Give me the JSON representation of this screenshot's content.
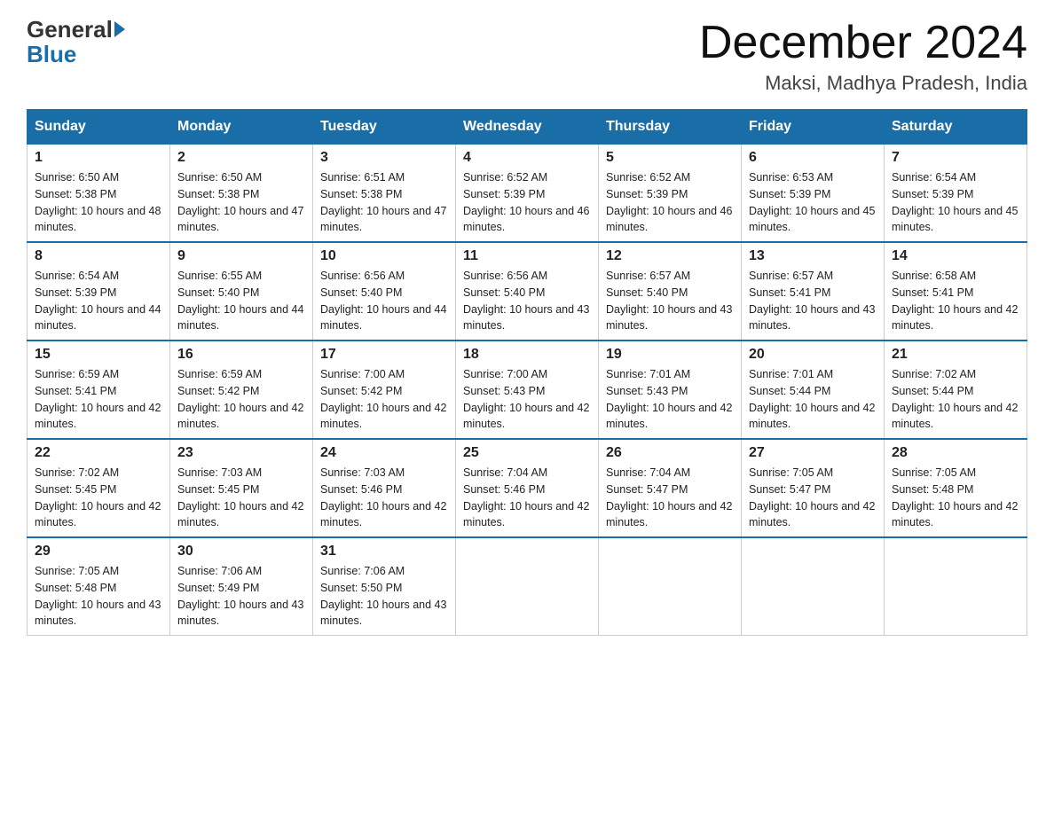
{
  "header": {
    "logo_general": "General",
    "logo_blue": "Blue",
    "title": "December 2024",
    "subtitle": "Maksi, Madhya Pradesh, India"
  },
  "days_of_week": [
    "Sunday",
    "Monday",
    "Tuesday",
    "Wednesday",
    "Thursday",
    "Friday",
    "Saturday"
  ],
  "weeks": [
    [
      {
        "day": "1",
        "sunrise": "6:50 AM",
        "sunset": "5:38 PM",
        "daylight": "10 hours and 48 minutes."
      },
      {
        "day": "2",
        "sunrise": "6:50 AM",
        "sunset": "5:38 PM",
        "daylight": "10 hours and 47 minutes."
      },
      {
        "day": "3",
        "sunrise": "6:51 AM",
        "sunset": "5:38 PM",
        "daylight": "10 hours and 47 minutes."
      },
      {
        "day": "4",
        "sunrise": "6:52 AM",
        "sunset": "5:39 PM",
        "daylight": "10 hours and 46 minutes."
      },
      {
        "day": "5",
        "sunrise": "6:52 AM",
        "sunset": "5:39 PM",
        "daylight": "10 hours and 46 minutes."
      },
      {
        "day": "6",
        "sunrise": "6:53 AM",
        "sunset": "5:39 PM",
        "daylight": "10 hours and 45 minutes."
      },
      {
        "day": "7",
        "sunrise": "6:54 AM",
        "sunset": "5:39 PM",
        "daylight": "10 hours and 45 minutes."
      }
    ],
    [
      {
        "day": "8",
        "sunrise": "6:54 AM",
        "sunset": "5:39 PM",
        "daylight": "10 hours and 44 minutes."
      },
      {
        "day": "9",
        "sunrise": "6:55 AM",
        "sunset": "5:40 PM",
        "daylight": "10 hours and 44 minutes."
      },
      {
        "day": "10",
        "sunrise": "6:56 AM",
        "sunset": "5:40 PM",
        "daylight": "10 hours and 44 minutes."
      },
      {
        "day": "11",
        "sunrise": "6:56 AM",
        "sunset": "5:40 PM",
        "daylight": "10 hours and 43 minutes."
      },
      {
        "day": "12",
        "sunrise": "6:57 AM",
        "sunset": "5:40 PM",
        "daylight": "10 hours and 43 minutes."
      },
      {
        "day": "13",
        "sunrise": "6:57 AM",
        "sunset": "5:41 PM",
        "daylight": "10 hours and 43 minutes."
      },
      {
        "day": "14",
        "sunrise": "6:58 AM",
        "sunset": "5:41 PM",
        "daylight": "10 hours and 42 minutes."
      }
    ],
    [
      {
        "day": "15",
        "sunrise": "6:59 AM",
        "sunset": "5:41 PM",
        "daylight": "10 hours and 42 minutes."
      },
      {
        "day": "16",
        "sunrise": "6:59 AM",
        "sunset": "5:42 PM",
        "daylight": "10 hours and 42 minutes."
      },
      {
        "day": "17",
        "sunrise": "7:00 AM",
        "sunset": "5:42 PM",
        "daylight": "10 hours and 42 minutes."
      },
      {
        "day": "18",
        "sunrise": "7:00 AM",
        "sunset": "5:43 PM",
        "daylight": "10 hours and 42 minutes."
      },
      {
        "day": "19",
        "sunrise": "7:01 AM",
        "sunset": "5:43 PM",
        "daylight": "10 hours and 42 minutes."
      },
      {
        "day": "20",
        "sunrise": "7:01 AM",
        "sunset": "5:44 PM",
        "daylight": "10 hours and 42 minutes."
      },
      {
        "day": "21",
        "sunrise": "7:02 AM",
        "sunset": "5:44 PM",
        "daylight": "10 hours and 42 minutes."
      }
    ],
    [
      {
        "day": "22",
        "sunrise": "7:02 AM",
        "sunset": "5:45 PM",
        "daylight": "10 hours and 42 minutes."
      },
      {
        "day": "23",
        "sunrise": "7:03 AM",
        "sunset": "5:45 PM",
        "daylight": "10 hours and 42 minutes."
      },
      {
        "day": "24",
        "sunrise": "7:03 AM",
        "sunset": "5:46 PM",
        "daylight": "10 hours and 42 minutes."
      },
      {
        "day": "25",
        "sunrise": "7:04 AM",
        "sunset": "5:46 PM",
        "daylight": "10 hours and 42 minutes."
      },
      {
        "day": "26",
        "sunrise": "7:04 AM",
        "sunset": "5:47 PM",
        "daylight": "10 hours and 42 minutes."
      },
      {
        "day": "27",
        "sunrise": "7:05 AM",
        "sunset": "5:47 PM",
        "daylight": "10 hours and 42 minutes."
      },
      {
        "day": "28",
        "sunrise": "7:05 AM",
        "sunset": "5:48 PM",
        "daylight": "10 hours and 42 minutes."
      }
    ],
    [
      {
        "day": "29",
        "sunrise": "7:05 AM",
        "sunset": "5:48 PM",
        "daylight": "10 hours and 43 minutes."
      },
      {
        "day": "30",
        "sunrise": "7:06 AM",
        "sunset": "5:49 PM",
        "daylight": "10 hours and 43 minutes."
      },
      {
        "day": "31",
        "sunrise": "7:06 AM",
        "sunset": "5:50 PM",
        "daylight": "10 hours and 43 minutes."
      },
      null,
      null,
      null,
      null
    ]
  ]
}
